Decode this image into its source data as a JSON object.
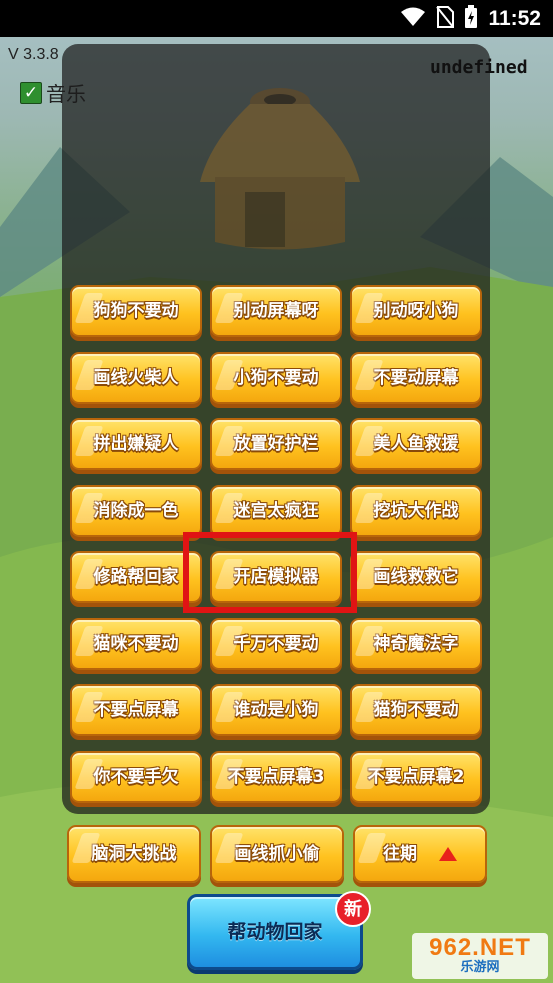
{
  "status_bar": {
    "time": "11:52",
    "icons": [
      "wifi-icon",
      "no-sim-icon",
      "battery-charging-icon"
    ]
  },
  "header": {
    "version": "V 3.3.8",
    "music_label": "音乐",
    "music_checked": true,
    "status_text": "undefined"
  },
  "levels": [
    [
      "狗狗不要动",
      "别动屏幕呀",
      "别动呀小狗"
    ],
    [
      "画线火柴人",
      "小狗不要动",
      "不要动屏幕"
    ],
    [
      "拼出嫌疑人",
      "放置好护栏",
      "美人鱼救援"
    ],
    [
      "消除成一色",
      "迷宫太疯狂",
      "挖坑大作战"
    ],
    [
      "修路帮回家",
      "开店模拟器",
      "画线救救它"
    ],
    [
      "猫咪不要动",
      "千万不要动",
      "神奇魔法字"
    ],
    [
      "不要点屏幕",
      "谁动是小狗",
      "猫狗不要动"
    ],
    [
      "你不要手欠",
      "不要点屏幕3",
      "不要点屏幕2"
    ]
  ],
  "bottom_row": {
    "left": "脑洞大挑战",
    "middle": "画线抓小偷",
    "period": "往期"
  },
  "feature_button": {
    "label": "帮动物回家",
    "badge": "新"
  },
  "watermark": {
    "top": "962.NET",
    "bottom": "乐游网"
  },
  "colors": {
    "button_yellow": "#ffc21f",
    "highlight_red": "#e01414",
    "feature_blue": "#33b8f0",
    "badge_red": "#e8202a"
  }
}
